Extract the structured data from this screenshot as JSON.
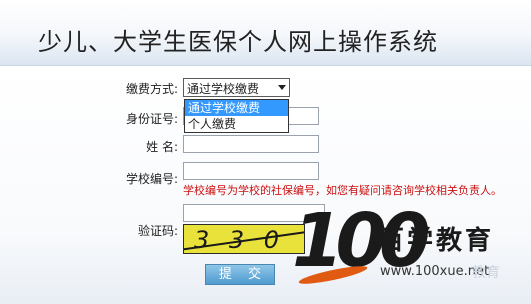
{
  "page": {
    "title": "少儿、大学生医保个人网上操作系统"
  },
  "form": {
    "payment_method_label": "缴费方式:",
    "payment_method_value": "通过学校缴费",
    "payment_options": [
      "通过学校缴费",
      "个人缴费"
    ],
    "id_number_label": "身份证号:",
    "id_number_value": "",
    "name_label": "姓 名:",
    "name_value": "",
    "school_code_label": "学校编号:",
    "school_code_value": "",
    "school_code_hint": "学校编号为学校的社保编号，如您有疑问请咨询学校相关负责人。",
    "captcha_label": "验证码:",
    "captcha_text": "3 3 0 9",
    "submit_label": "提 交"
  },
  "watermark": {
    "logo_number": "100",
    "brand": "百学教育",
    "url": "www.100xue.net",
    "ghost_text": "教育"
  },
  "colors": {
    "hint_red": "#cc1111",
    "selection_blue": "#3399ff",
    "captcha_yellow": "#e8e23a",
    "submit_blue": "#4f9bd0",
    "brand_orange": "#e05a12"
  }
}
